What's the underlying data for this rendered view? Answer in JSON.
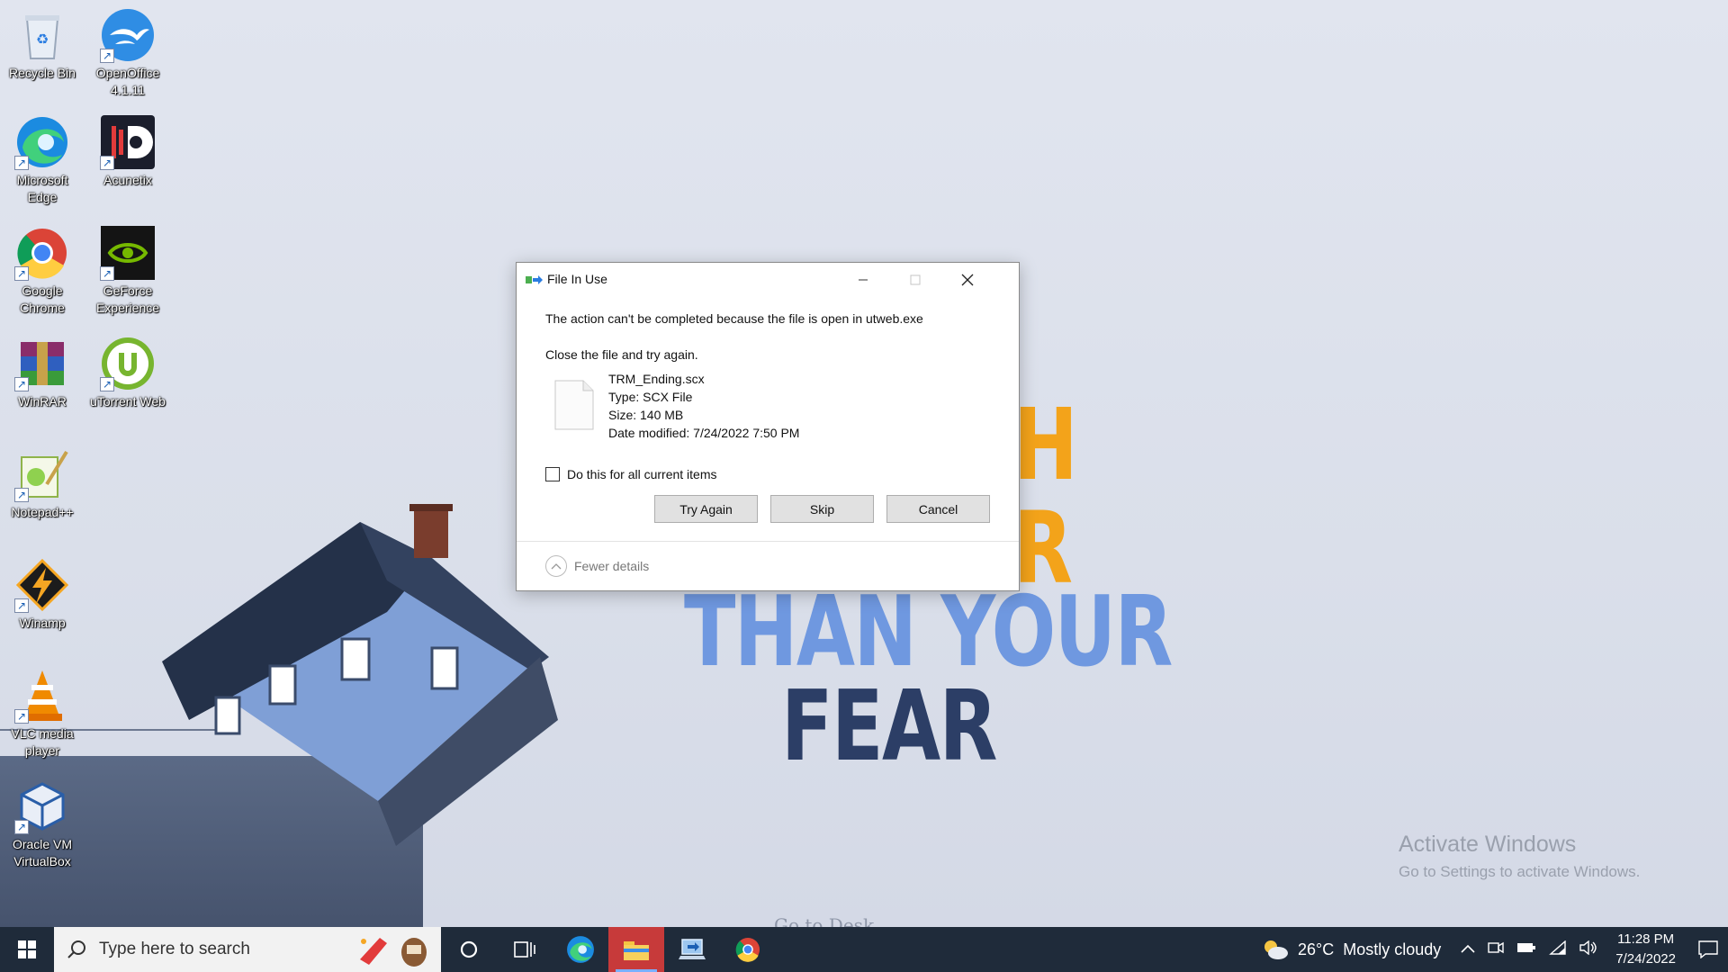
{
  "desktop": {
    "wallpaper_text": [
      "H",
      "R",
      "THAN YOUR",
      "FEAR"
    ],
    "wallpaper_credit": "Go to Desk",
    "icons": [
      {
        "label": "Recycle Bin",
        "icon": "recycle-bin-icon"
      },
      {
        "label": "OpenOffice 4.1.11",
        "icon": "openoffice-icon"
      },
      {
        "label": "Microsoft Edge",
        "icon": "edge-icon"
      },
      {
        "label": "Acunetix",
        "icon": "acunetix-icon"
      },
      {
        "label": "Google Chrome",
        "icon": "chrome-icon"
      },
      {
        "label": "GeForce Experience",
        "icon": "geforce-icon"
      },
      {
        "label": "WinRAR",
        "icon": "winrar-icon"
      },
      {
        "label": "uTorrent Web",
        "icon": "utorrent-icon"
      },
      {
        "label": "Notepad++",
        "icon": "notepadpp-icon"
      },
      {
        "label": "Winamp",
        "icon": "winamp-icon"
      },
      {
        "label": "VLC media player",
        "icon": "vlc-icon"
      },
      {
        "label": "Oracle VM VirtualBox",
        "icon": "virtualbox-icon"
      }
    ],
    "activate": {
      "title": "Activate Windows",
      "subtitle": "Go to Settings to activate Windows."
    }
  },
  "dialog": {
    "title": "File In Use",
    "message": "The action can't be completed because the file is open in utweb.exe",
    "instruction": "Close the file and try again.",
    "file": {
      "name": "TRM_Ending.scx",
      "type": "Type: SCX File",
      "size": "Size: 140 MB",
      "modified": "Date modified: 7/24/2022 7:50 PM"
    },
    "checkbox_label": "Do this for all current items",
    "checkbox_checked": false,
    "buttons": {
      "try_again": "Try Again",
      "skip": "Skip",
      "cancel": "Cancel"
    },
    "details_toggle": "Fewer details"
  },
  "taskbar": {
    "search_placeholder": "Type here to search",
    "apps": [
      "cortana-icon",
      "task-view-icon",
      "edge-icon",
      "file-explorer-icon",
      "file-transfer-icon",
      "chrome-icon"
    ],
    "active_app": "file-explorer-icon",
    "weather": {
      "temp": "26°C",
      "condition": "Mostly cloudy"
    },
    "clock": {
      "time": "11:28 PM",
      "date": "7/24/2022"
    }
  },
  "colors": {
    "taskbar_bg": "#1f2b3a",
    "wallpaper_orange": "#f3a31a",
    "wallpaper_lightblue": "#6f98e0",
    "wallpaper_navy": "#2c3e66",
    "dialog_button_bg": "#e1e1e1"
  }
}
